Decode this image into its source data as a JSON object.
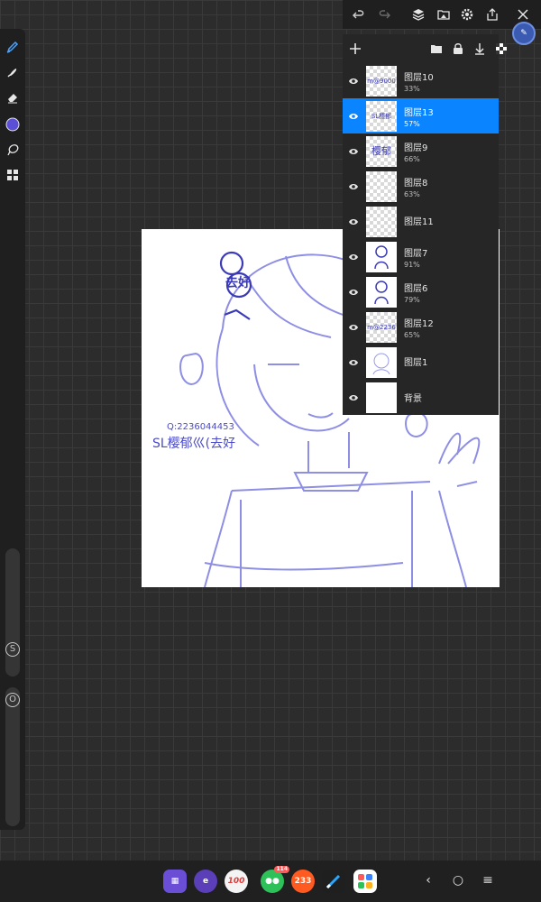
{
  "colors": {
    "accent": "#0a84ff",
    "brush_color": "#5b4fd6",
    "sketch": "#5a5ad6"
  },
  "left_toolbar": {
    "tools": [
      "brush-icon",
      "smudge-icon",
      "eraser-icon",
      "color-swatch",
      "lasso-icon",
      "gallery-icon"
    ],
    "size_label": "S",
    "opacity_label": "O"
  },
  "top_toolbar": {
    "buttons": [
      "undo-icon",
      "redo-icon",
      "layers-icon",
      "import-image-icon",
      "settings-icon",
      "share-icon",
      "close-icon"
    ]
  },
  "layers_panel": {
    "header_buttons": [
      "add-layer-icon",
      "folder-icon",
      "lock-icon",
      "merge-down-icon",
      "transparency-icon",
      "settings-icon"
    ],
    "layers": [
      {
        "name": "图层10",
        "opacity": "33%",
        "thumb_text": "m@9000"
      },
      {
        "name": "图层13",
        "opacity": "57%",
        "thumb_text": "SL樱郁"
      },
      {
        "name": "图层9",
        "opacity": "66%",
        "thumb_text": "樱郁"
      },
      {
        "name": "图层8",
        "opacity": "63%",
        "thumb_text": ""
      },
      {
        "name": "图层11",
        "opacity": "",
        "thumb_text": ""
      },
      {
        "name": "图层7",
        "opacity": "91%",
        "thumb_text": ""
      },
      {
        "name": "图层6",
        "opacity": "79%",
        "thumb_text": ""
      },
      {
        "name": "图层12",
        "opacity": "65%",
        "thumb_text": "m@2236"
      },
      {
        "name": "图层1",
        "opacity": "",
        "thumb_text": ""
      },
      {
        "name": "背景",
        "opacity": "",
        "thumb_text": ""
      }
    ],
    "selected_index": 1
  },
  "canvas": {
    "signature_line1": "Q:2236044453",
    "signature_line2": "SL樱郁巛(去好",
    "stamp_text": "去好"
  },
  "dock": {
    "apps": [
      "calculator-app",
      "browser-app",
      "100-app",
      "wechat-app",
      "bilibili-233-app",
      "drawing-app",
      "app-drawer"
    ],
    "app_100_label": "100",
    "app_233_label": "233",
    "wechat_badge": "114",
    "nav": {
      "back": "‹",
      "home": "○",
      "menu": "≡"
    }
  }
}
